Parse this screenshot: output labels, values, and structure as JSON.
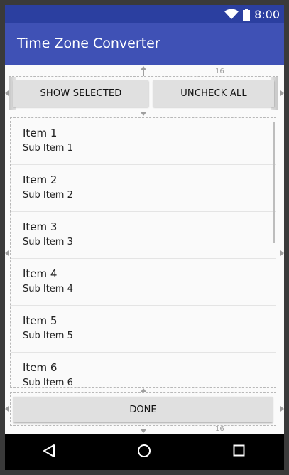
{
  "status_bar": {
    "time": "8:00",
    "icons": [
      "wifi-icon",
      "battery-icon"
    ]
  },
  "app_bar": {
    "title": "Time Zone Converter"
  },
  "guides": {
    "top_margin": "16",
    "bottom_margin": "16"
  },
  "buttons": {
    "show_selected": "SHOW SELECTED",
    "uncheck_all": "UNCHECK ALL",
    "done": "DONE"
  },
  "list": {
    "items": [
      {
        "title": "Item 1",
        "subtitle": "Sub Item 1"
      },
      {
        "title": "Item 2",
        "subtitle": "Sub Item 2"
      },
      {
        "title": "Item 3",
        "subtitle": "Sub Item 3"
      },
      {
        "title": "Item 4",
        "subtitle": "Sub Item 4"
      },
      {
        "title": "Item 5",
        "subtitle": "Sub Item 5"
      },
      {
        "title": "Item 6",
        "subtitle": "Sub Item 6"
      }
    ]
  },
  "nav_bar": {
    "icons": [
      "back-icon",
      "home-icon",
      "recents-icon"
    ]
  },
  "colors": {
    "primary": "#3f51b5",
    "primary_dark": "#2b3fa0",
    "button": "#e0e0e0",
    "background": "#fafafa"
  }
}
